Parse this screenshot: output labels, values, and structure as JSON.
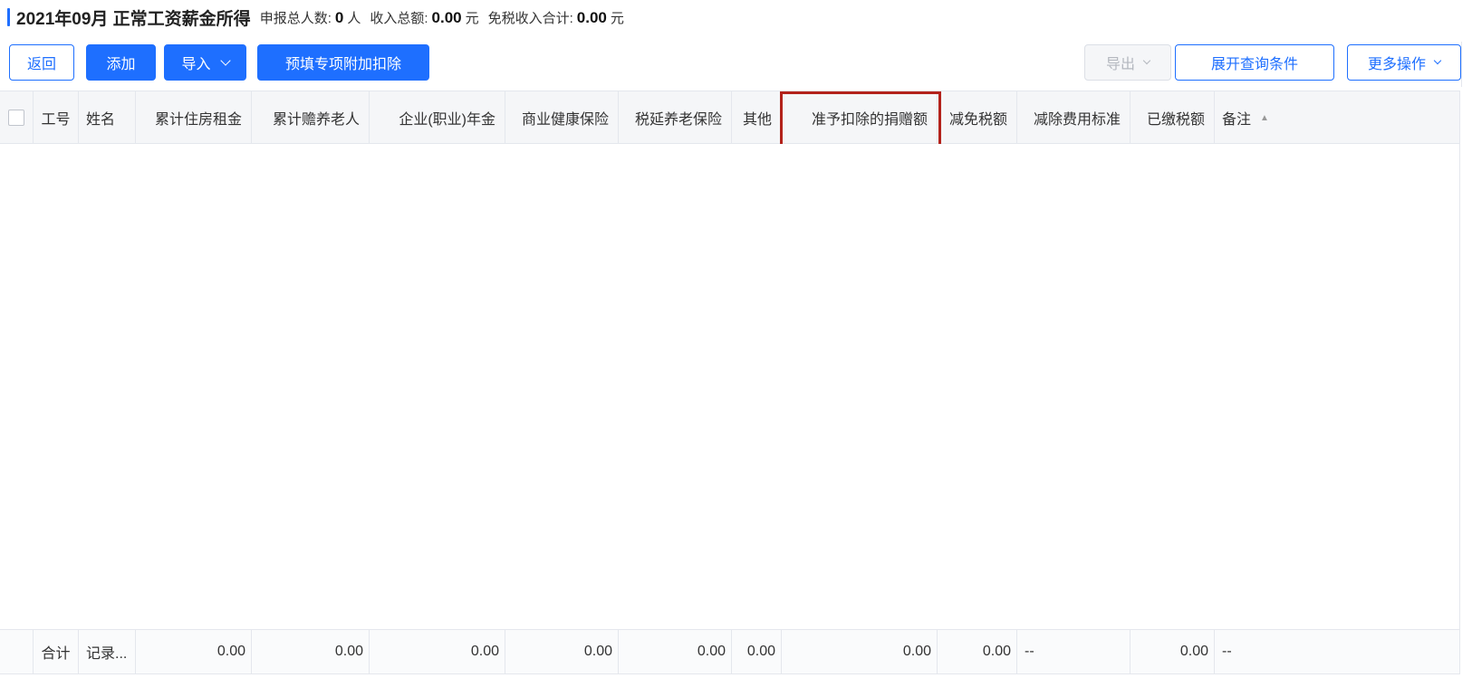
{
  "header": {
    "title": "2021年09月 正常工资薪金所得",
    "stats": [
      {
        "label": "申报总人数:",
        "value": "0",
        "unit": "人"
      },
      {
        "label": "收入总额:",
        "value": "0.00",
        "unit": "元"
      },
      {
        "label": "免税收入合计:",
        "value": "0.00",
        "unit": "元"
      }
    ]
  },
  "toolbar": {
    "back": "返回",
    "add": "添加",
    "import": "导入",
    "prefill": "预填专项附加扣除",
    "export": "导出",
    "expand_query": "展开查询条件",
    "more_ops": "更多操作"
  },
  "table": {
    "columns": [
      "工号",
      "姓名",
      "累计住房租金",
      "累计赡养老人",
      "企业(职业)年金",
      "商业健康保险",
      "税延养老保险",
      "其他",
      "准予扣除的捐赠额",
      "减免税额",
      "减除费用标准",
      "已缴税额",
      "备注"
    ],
    "sort_indicator": "▲",
    "footer": [
      "合计",
      "记录...",
      "0.00",
      "0.00",
      "0.00",
      "0.00",
      "0.00",
      "0.00",
      "0.00",
      "0.00",
      "--",
      "0.00",
      "--"
    ]
  },
  "colors": {
    "primary": "#1e6fff",
    "highlight_border": "#b3221b",
    "header_bg": "#f5f6f8"
  }
}
